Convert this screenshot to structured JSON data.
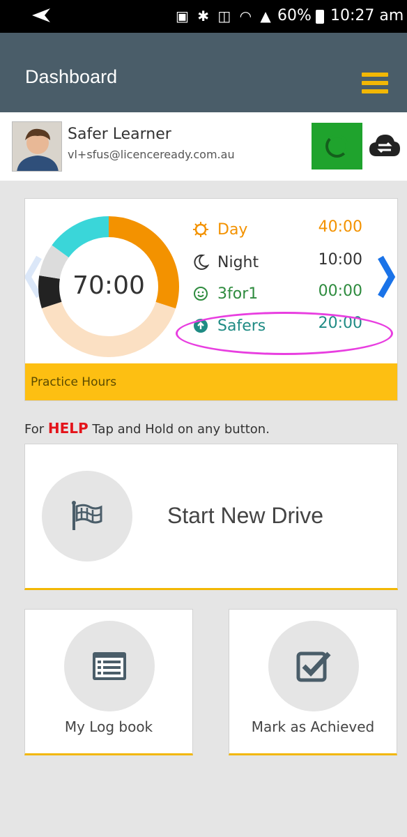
{
  "status_bar": {
    "battery_pct": "60%",
    "time": "10:27 am"
  },
  "app_bar": {
    "title": "Dashboard"
  },
  "profile": {
    "name": "Safer Learner",
    "email": "vl+sfus@licenceready.com.au"
  },
  "hours": {
    "total": "70:00",
    "footer": "Practice Hours",
    "rows": [
      {
        "label": "Day",
        "value": "40:00",
        "icon": "sun-icon",
        "color": "#f39200"
      },
      {
        "label": "Night",
        "value": "10:00",
        "icon": "moon-icon",
        "color": "#333333"
      },
      {
        "label": "3for1",
        "value": "00:00",
        "icon": "smiley-icon",
        "color": "#2e8b3e"
      },
      {
        "label": "Safers",
        "value": "20:00",
        "icon": "arrow-up-circle-icon",
        "color": "#1f8b84"
      }
    ],
    "ring_segments": [
      {
        "name": "Day",
        "fraction": 0.3,
        "color": "#f39200"
      },
      {
        "name": "Remaining",
        "fraction": 0.4,
        "color": "#fbe0c3"
      },
      {
        "name": "Night",
        "fraction": 0.075,
        "color": "#222222"
      },
      {
        "name": "3for1",
        "fraction": 0.075,
        "color": "#dcdcdc"
      },
      {
        "name": "Safers",
        "fraction": 0.15,
        "color": "#3ad6d9"
      }
    ]
  },
  "help": {
    "prefix": "For ",
    "keyword": "HELP",
    "suffix": " Tap and Hold on any button."
  },
  "actions": {
    "start_drive": "Start New Drive",
    "log_book": "My Log book",
    "mark_achieved": "Mark as Achieved"
  },
  "colors": {
    "app_bar": "#4a5d69",
    "accent": "#f2b705",
    "sync_ok": "#1fa32d",
    "help": "#e4141b",
    "nav_arrow": "#1a73e8"
  }
}
